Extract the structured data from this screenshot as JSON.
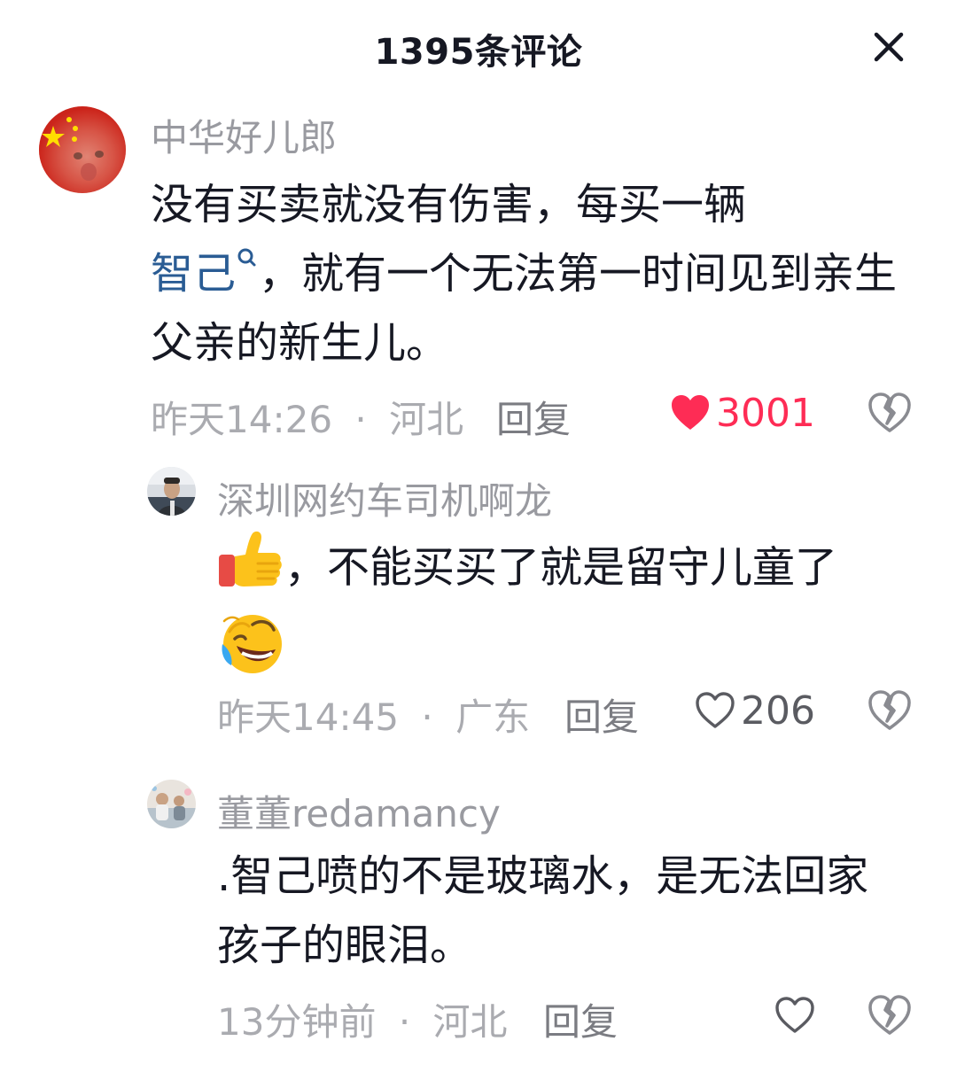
{
  "header": {
    "title": "1395条评论",
    "close_icon": "close-icon"
  },
  "colors": {
    "liked_red": "#fe2c55",
    "topic_blue": "#2a5c94",
    "meta_gray": "#aaabb0",
    "username_gray": "#999aa0"
  },
  "comments": [
    {
      "username": "中华好儿郎",
      "text_before_link": "没有买卖就没有伤害，每买一辆",
      "topic_link": "智己",
      "text_after_link": "，就有一个无法第一时间见到亲生父亲的新生儿。",
      "time": "昨天14:26",
      "separator": "·",
      "location": "河北",
      "reply_label": "回复",
      "like_count": "3001",
      "liked": true,
      "replies": [
        {
          "username": "深圳网约车司机啊龙",
          "emoji_before": "thumbs-up-emoji",
          "text": "，不能买买了就是留守儿童了",
          "emoji_after": "rolling-on-floor-laughing-emoji",
          "time": "昨天14:45",
          "separator": "·",
          "location": "广东",
          "reply_label": "回复",
          "like_count": "206",
          "liked": false
        },
        {
          "username": "董董redamancy",
          "text": ".智己喷的不是玻璃水，是无法回家孩子的眼泪。",
          "time": "13分钟前",
          "separator": "·",
          "location": "河北",
          "reply_label": "回复",
          "like_count": "",
          "liked": false
        }
      ]
    }
  ]
}
